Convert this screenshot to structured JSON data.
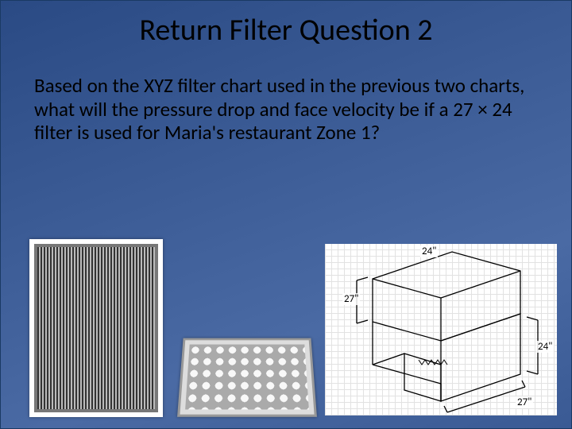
{
  "slide": {
    "title": "Return Filter Question 2",
    "body": "Based on the XYZ filter chart used in the previous two charts, what will the pressure drop and face velocity be if a 27 × 24 filter is used for Maria's restaurant Zone 1?"
  },
  "diagram": {
    "dim_top_left": "27\"",
    "dim_top_right": "24\"",
    "dim_right": "24\"",
    "dim_bottom": "27\""
  }
}
